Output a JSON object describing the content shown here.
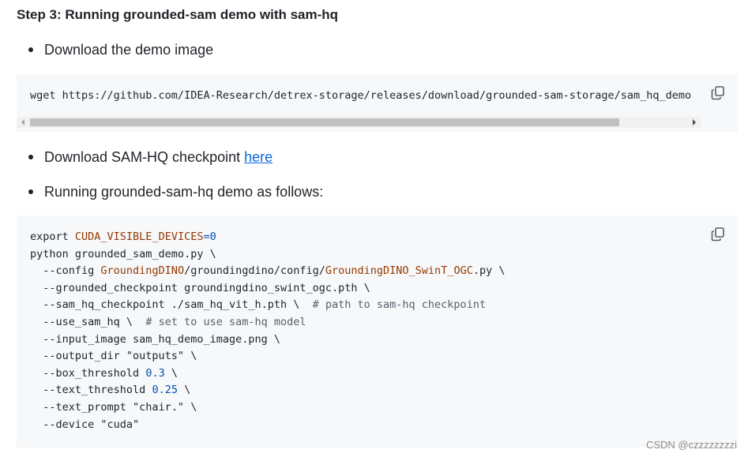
{
  "step_title": "Step 3: Running grounded-sam demo with sam-hq",
  "bullets": {
    "download_demo": "Download the demo image",
    "download_ckpt_prefix": "Download SAM-HQ checkpoint ",
    "download_ckpt_link": "here",
    "running": "Running grounded-sam-hq demo as follows:"
  },
  "code_block_1": {
    "line": "wget https://github.com/IDEA-Research/detrex-storage/releases/download/grounded-sam-storage/sam_hq_demo"
  },
  "code_block_2": {
    "l1_a": "export ",
    "l1_b": "CUDA_VISIBLE_DEVICES",
    "l1_c": "=0",
    "l2": "python grounded_sam_demo.py \\",
    "l3_a": "  --config ",
    "l3_b": "GroundingDINO",
    "l3_c": "/groundingdino/config/",
    "l3_d": "GroundingDINO_SwinT_OGC",
    "l3_e": ".py \\",
    "l4": "  --grounded_checkpoint groundingdino_swint_ogc.pth \\",
    "l5_a": "  --sam_hq_checkpoint ./sam_hq_vit_h.pth \\  ",
    "l5_b": "# path to sam-hq checkpoint",
    "l6_a": "  --use_sam_hq \\  ",
    "l6_b": "# set to use sam-hq model",
    "l7": "  --input_image sam_hq_demo_image.png \\",
    "l8": "  --output_dir \"outputs\" \\",
    "l9_a": "  --box_threshold ",
    "l9_b": "0.3",
    "l9_c": " \\",
    "l10_a": "  --text_threshold ",
    "l10_b": "0.25",
    "l10_c": " \\",
    "l11": "  --text_prompt \"chair.\" \\",
    "l12": "  --device \"cuda\""
  },
  "icons": {
    "copy": "copy-icon"
  },
  "watermark": "CSDN @czzzzzzzzi",
  "colors": {
    "code_bg": "#f6f8fa",
    "link": "#0969da",
    "token_orange": "#953800",
    "token_blue": "#0550ae",
    "comment_gray": "#57606a"
  }
}
